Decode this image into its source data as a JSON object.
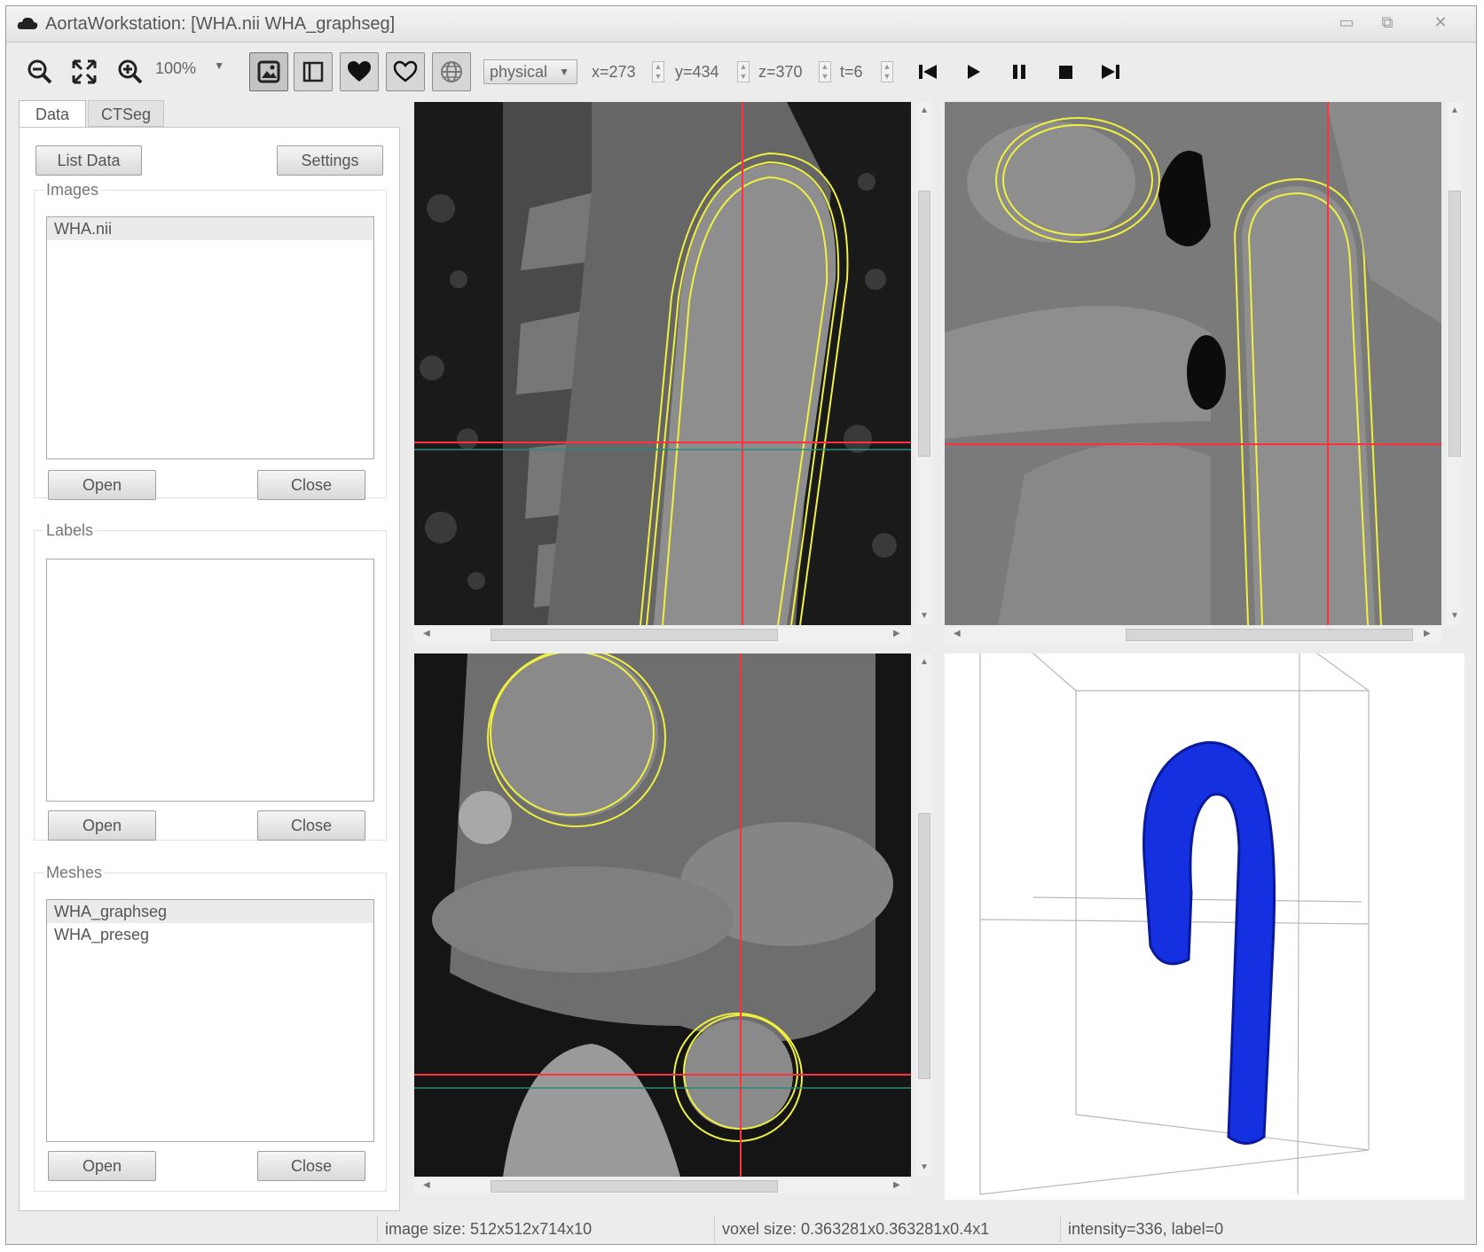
{
  "window": {
    "title": "AortaWorkstation: [WHA.nii  WHA_graphseg]",
    "controls": [
      "minimize-icon",
      "maximize-icon",
      "close-icon"
    ]
  },
  "toolbar": {
    "zoom_value": "100%",
    "space_mode": "physical",
    "coords": {
      "x": "x=273",
      "y": "y=434",
      "z": "z=370",
      "t": "t=6"
    },
    "icons": [
      "zoom-out-icon",
      "fit-icon",
      "zoom-in-icon",
      "image-view-icon",
      "layout-icon",
      "heart-filled-icon",
      "heart-outline-icon",
      "globe-icon",
      "skip-back-icon",
      "play-icon",
      "pause-icon",
      "stop-icon",
      "skip-forward-icon"
    ]
  },
  "tabs": [
    "Data",
    "CTSeg"
  ],
  "left_panel": {
    "list_data_label": "List Data",
    "settings_label": "Settings",
    "images": {
      "label": "Images",
      "items": [
        "WHA.nii"
      ],
      "open": "Open",
      "close": "Close"
    },
    "labels": {
      "label": "Labels",
      "items": [],
      "open": "Open",
      "close": "Close"
    },
    "meshes": {
      "label": "Meshes",
      "items": [
        "WHA_graphseg",
        "WHA_preseg"
      ],
      "open": "Open",
      "close": "Close"
    }
  },
  "status": {
    "image_size": "image size: 512x512x714x10",
    "voxel_size": "voxel size: 0.363281x0.363281x0.4x1",
    "intensity": "intensity=336, label=0"
  },
  "colors": {
    "crosshair": "#ff3040",
    "contour": "#f0f040",
    "mesh": "#1530e0"
  }
}
